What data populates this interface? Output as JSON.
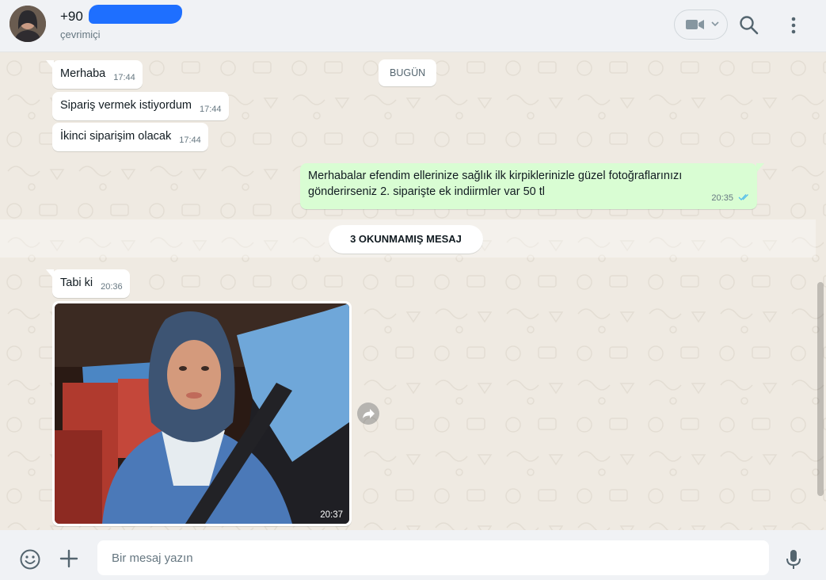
{
  "header": {
    "contact_name": "+90",
    "status": "çevrimiçi",
    "icons": [
      "avatar",
      "video-call-icon",
      "chevron-down-icon",
      "search-icon",
      "more-menu-icon"
    ]
  },
  "chat": {
    "date_chip": "BUGÜN",
    "messages": [
      {
        "dir": "in",
        "text": "Merhaba",
        "time": "17:44"
      },
      {
        "dir": "in",
        "text": "Sipariş vermek istiyordum",
        "time": "17:44"
      },
      {
        "dir": "in",
        "text": "İkinci siparişim olacak",
        "time": "17:44"
      },
      {
        "dir": "out",
        "text": "Merhabalar efendim ellerinize sağlık ilk kirpiklerinizle güzel fotoğraflarınızı gönderirseniz 2. siparişte ek indiirmler var 50 tl",
        "time": "20:35",
        "status": "read"
      },
      {
        "dir": "in",
        "text": "Tabi ki",
        "time": "20:36"
      },
      {
        "dir": "in",
        "type": "image",
        "time": "20:37"
      }
    ],
    "unread_banner": "3 OKUNMAMIŞ MESAJ"
  },
  "footer": {
    "placeholder": "Bir mesaj yazın",
    "icons": [
      "emoji-icon",
      "plus-icon",
      "microphone-icon"
    ]
  },
  "colors": {
    "chat_bg": "#efeae2",
    "outgoing_bubble": "#d9fdd3",
    "incoming_bubble": "#ffffff",
    "read_ticks": "#53bdeb",
    "header_bg": "#f0f2f5"
  }
}
